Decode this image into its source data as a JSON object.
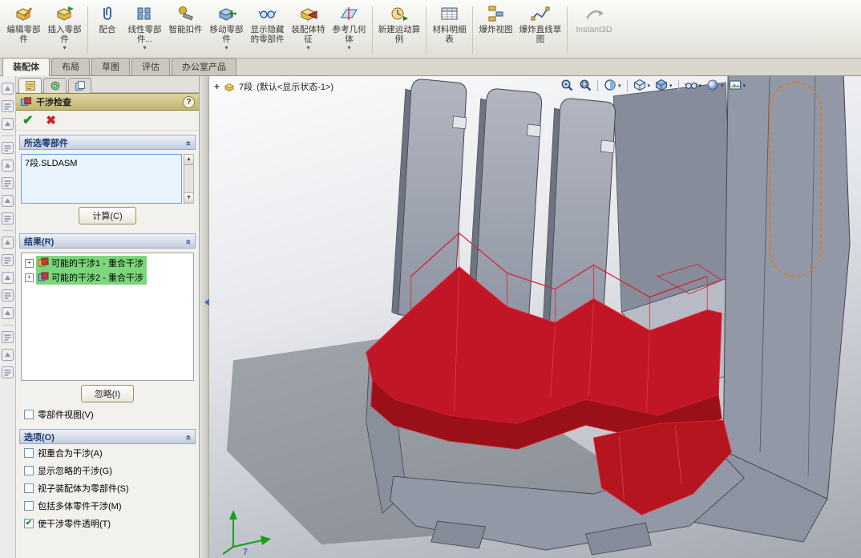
{
  "toolbar": {
    "buttons": [
      {
        "label": "编辑零部件",
        "dropdown": false
      },
      {
        "label": "插入零部件",
        "dropdown": true
      },
      {
        "label": "配合",
        "dropdown": false
      },
      {
        "label": "线性零部件...",
        "dropdown": true
      },
      {
        "label": "智能扣件",
        "dropdown": false
      },
      {
        "label": "移动零部件",
        "dropdown": true
      },
      {
        "label": "显示隐藏的零部件",
        "dropdown": false
      },
      {
        "label": "装配体特征",
        "dropdown": true
      },
      {
        "label": "参考几何体",
        "dropdown": true
      },
      {
        "label": "新建运动算例",
        "dropdown": false
      },
      {
        "label": "材料明细表",
        "dropdown": false
      },
      {
        "label": "爆炸视图",
        "dropdown": false
      },
      {
        "label": "爆炸直线草图",
        "dropdown": false
      },
      {
        "label": "Instant3D",
        "dropdown": false,
        "disabled": true
      }
    ]
  },
  "tabs": {
    "items": [
      {
        "label": "装配体",
        "active": true
      },
      {
        "label": "布局",
        "active": false
      },
      {
        "label": "草图",
        "active": false
      },
      {
        "label": "评估",
        "active": false
      },
      {
        "label": "办公室产品",
        "active": false
      }
    ]
  },
  "property_manager": {
    "title": "干涉检查",
    "help_label": "?",
    "selected_components": {
      "header": "所选零部件",
      "selection": "7段.SLDASM",
      "calculate_button": "计算(C)"
    },
    "results": {
      "header": "结果(R)",
      "items": [
        {
          "label": "可能的干涉1 - 重合干涉",
          "selected": true
        },
        {
          "label": "可能的干涉2 - 重合干涉",
          "selected": true
        }
      ],
      "ignore_button": "忽略(I)",
      "component_view": {
        "label": "零部件视图(V)",
        "checked": false
      }
    },
    "options": {
      "header": "选项(O)",
      "checkboxes": [
        {
          "label": "视重合为干涉(A)",
          "checked": false
        },
        {
          "label": "显示忽略的干涉(G)",
          "checked": false
        },
        {
          "label": "视子装配体为零部件(S)",
          "checked": false
        },
        {
          "label": "包括多体零件干涉(M)",
          "checked": false
        },
        {
          "label": "使干涉零件透明(T)",
          "checked": true
        }
      ]
    }
  },
  "viewport": {
    "tree_expander": "+",
    "tree_node": "7段",
    "tree_config": "(默认<显示状态-1>)",
    "triad_label": "7",
    "colors": {
      "interference_red": "#c11626",
      "model_gray": "#9298a6",
      "selection_orange": "#e2791a",
      "result_highlight_green": "#7cd67c"
    }
  },
  "view_toolbar": {
    "icons": [
      "zoom-fit",
      "zoom-area",
      "section-view",
      "view-orientation",
      "display-style",
      "hide-show-items",
      "appearances",
      "scene"
    ]
  }
}
